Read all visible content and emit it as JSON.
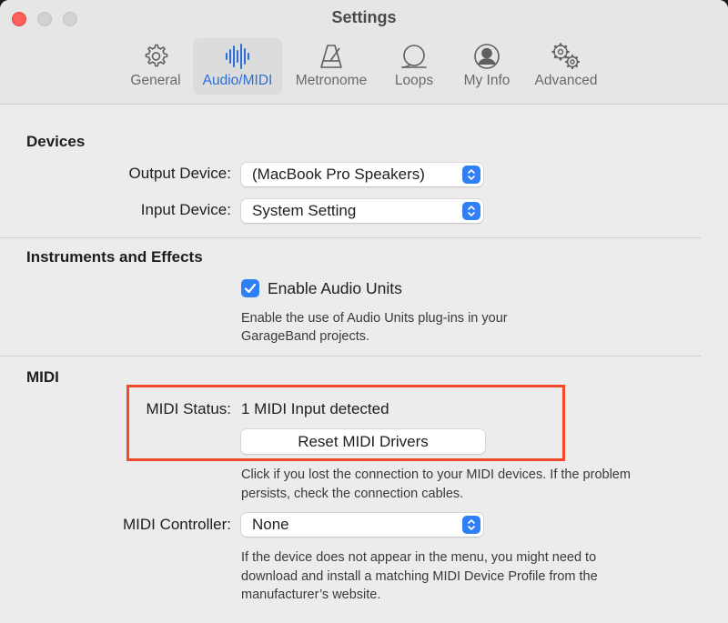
{
  "window": {
    "title": "Settings"
  },
  "toolbar": {
    "tabs": [
      {
        "label": "General",
        "icon": "gear-icon"
      },
      {
        "label": "Audio/MIDI",
        "icon": "waveform-icon",
        "active": true
      },
      {
        "label": "Metronome",
        "icon": "metronome-icon"
      },
      {
        "label": "Loops",
        "icon": "loop-icon"
      },
      {
        "label": "My Info",
        "icon": "person-circle-icon"
      },
      {
        "label": "Advanced",
        "icon": "gears-icon"
      }
    ]
  },
  "devices": {
    "title": "Devices",
    "output_label": "Output Device:",
    "output_value": "(MacBook Pro Speakers)",
    "input_label": "Input Device:",
    "input_value": "System Setting"
  },
  "instruments": {
    "title": "Instruments and Effects",
    "checkbox_label": "Enable Audio Units",
    "checkbox_checked": true,
    "help_line1": "Enable the use of Audio Units plug-ins in your",
    "help_line2": "GarageBand projects."
  },
  "midi": {
    "title": "MIDI",
    "status_label": "MIDI Status:",
    "status_value": "1 MIDI Input detected",
    "reset_label": "Reset MIDI Drivers",
    "reset_help_line1": "Click if you lost the connection to your MIDI devices. If the problem",
    "reset_help_line2": "persists, check the connection cables.",
    "controller_label": "MIDI Controller:",
    "controller_value": "None",
    "controller_help_line1": "If the device does not appear in the menu, you might need to",
    "controller_help_line2": "download and install a matching MIDI Device Profile from the",
    "controller_help_line3": "manufacturer’s website."
  },
  "colors": {
    "accent": "#2f7ff5",
    "active_tab_text": "#2b6fd6",
    "highlight": "#f04a2a"
  }
}
